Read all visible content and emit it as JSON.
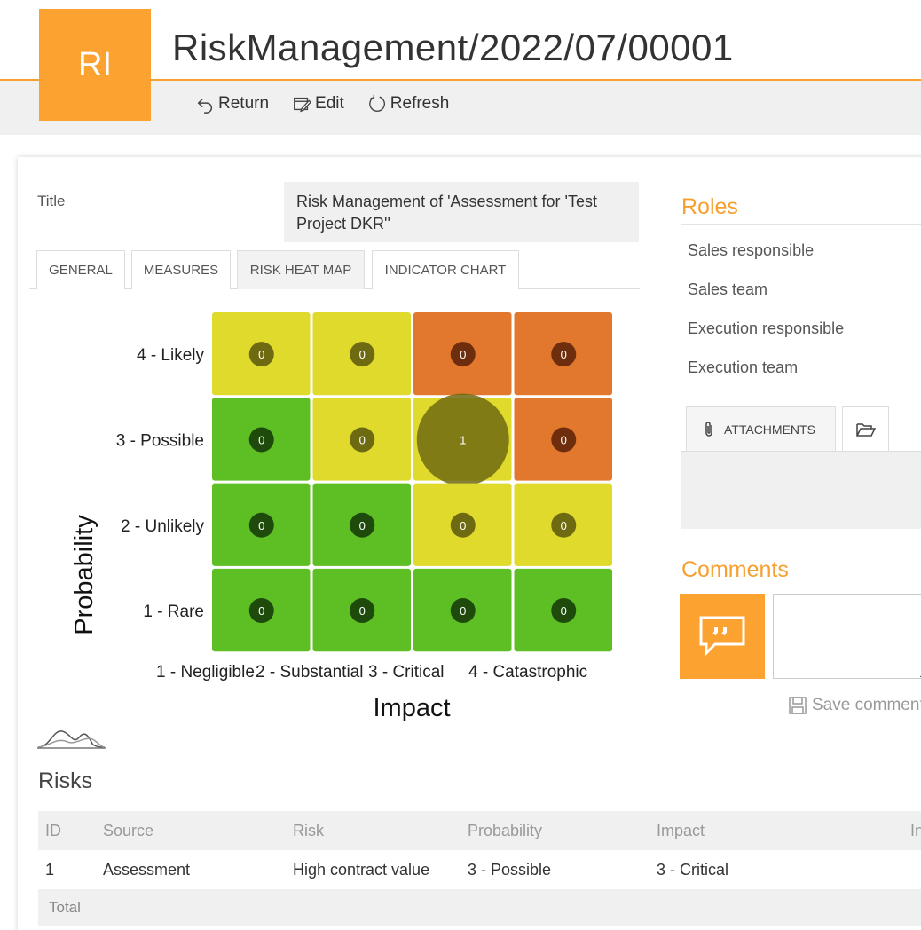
{
  "header": {
    "avatar_initials": "RI",
    "record_title": "RiskManagement/2022/07/00001",
    "toolbar": {
      "return_label": "Return",
      "edit_label": "Edit",
      "refresh_label": "Refresh"
    },
    "accent_color": "#fca231"
  },
  "form": {
    "title_label": "Title",
    "title_value": "Risk Management of 'Assessment for 'Test Project DKR''",
    "tabs": [
      {
        "label": "GENERAL",
        "active": false
      },
      {
        "label": "MEASURES",
        "active": false
      },
      {
        "label": "RISK HEAT MAP",
        "active": true
      },
      {
        "label": "INDICATOR CHART",
        "active": false
      }
    ]
  },
  "heatmap": {
    "y_axis_label": "Probability",
    "x_axis_label": "Impact",
    "rows": [
      "4 - Likely",
      "3 - Possible",
      "2 - Unlikely",
      "1 - Rare"
    ],
    "columns": [
      "1 - Negligible",
      "2 - Substantial",
      "3 - Critical",
      "4 - Catastrophic"
    ],
    "cells": [
      [
        {
          "count": 0,
          "level": "medium"
        },
        {
          "count": 0,
          "level": "medium"
        },
        {
          "count": 0,
          "level": "high"
        },
        {
          "count": 0,
          "level": "high"
        }
      ],
      [
        {
          "count": 0,
          "level": "low"
        },
        {
          "count": 0,
          "level": "medium"
        },
        {
          "count": 1,
          "level": "medium"
        },
        {
          "count": 0,
          "level": "high"
        }
      ],
      [
        {
          "count": 0,
          "level": "low"
        },
        {
          "count": 0,
          "level": "low"
        },
        {
          "count": 0,
          "level": "medium"
        },
        {
          "count": 0,
          "level": "medium"
        }
      ],
      [
        {
          "count": 0,
          "level": "low"
        },
        {
          "count": 0,
          "level": "low"
        },
        {
          "count": 0,
          "level": "low"
        },
        {
          "count": 0,
          "level": "low"
        }
      ]
    ],
    "level_colors": {
      "low": "#5dbf24",
      "medium": "#e0da2d",
      "high": "#e2782d"
    }
  },
  "roles": {
    "heading": "Roles",
    "items": [
      "Sales responsible",
      "Sales team",
      "Execution responsible",
      "Execution team"
    ]
  },
  "attachments": {
    "tab_label": "ATTACHMENTS"
  },
  "comments": {
    "heading": "Comments",
    "save_label": "Save comment"
  },
  "risks": {
    "heading": "Risks",
    "columns": [
      "ID",
      "Source",
      "Risk",
      "Probability",
      "Impact",
      "In"
    ],
    "rows": [
      {
        "id": "1",
        "source": "Assessment",
        "risk": "High contract value",
        "probability": "3 - Possible",
        "impact": "3 - Critical"
      }
    ],
    "total_label": "Total"
  }
}
